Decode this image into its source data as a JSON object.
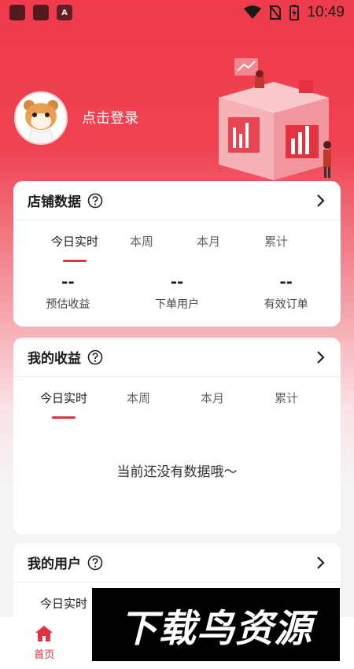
{
  "status_bar": {
    "time": "10:49"
  },
  "profile": {
    "login_label": "点击登录"
  },
  "store_card": {
    "title": "店铺数据",
    "tabs": [
      "今日实时",
      "本周",
      "本月",
      "累计"
    ],
    "stats": [
      {
        "value": "--",
        "label": "预估收益"
      },
      {
        "value": "--",
        "label": "下单用户"
      },
      {
        "value": "--",
        "label": "有效订单"
      }
    ]
  },
  "income_card": {
    "title": "我的收益",
    "tabs": [
      "今日实时",
      "本周",
      "本月",
      "累计"
    ],
    "empty_message": "当前还没有数据哦～"
  },
  "users_card": {
    "title": "我的用户",
    "tabs": [
      "今日实时"
    ]
  },
  "bottom_nav": {
    "items": [
      {
        "label": "首页",
        "icon": "home-icon",
        "active": true
      },
      {
        "label": "",
        "icon": "tab2-icon",
        "active": false
      },
      {
        "label": "",
        "icon": "tab3-icon",
        "active": false
      },
      {
        "label": "",
        "icon": "tab4-icon",
        "active": false
      }
    ]
  },
  "watermark": {
    "text": "下载鸟资源"
  },
  "colors": {
    "accent": "#e5303f",
    "header_bg": "#ef3b4b"
  }
}
